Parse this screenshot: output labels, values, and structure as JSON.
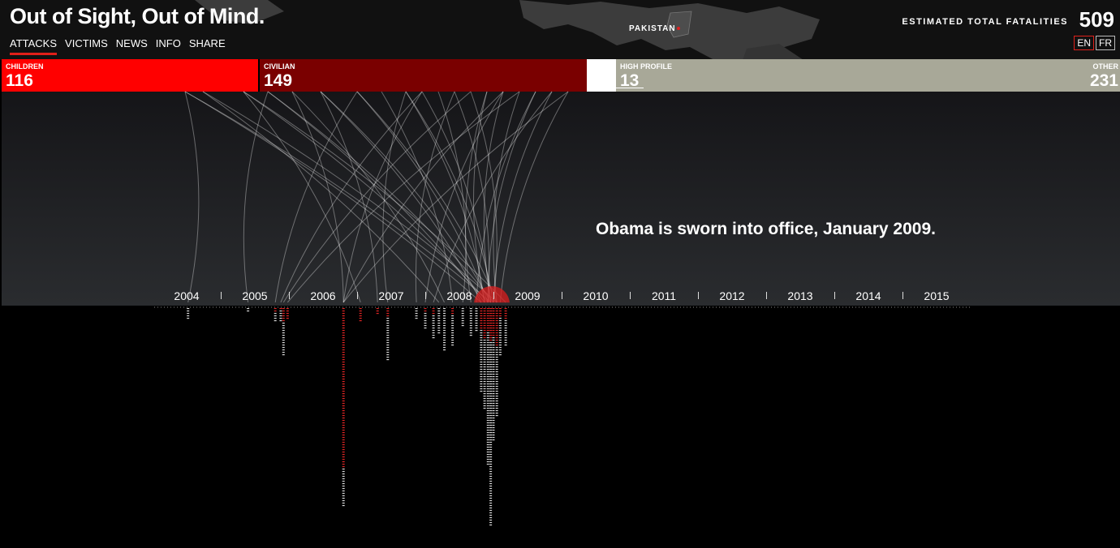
{
  "header": {
    "title": "Out of Sight, Out of Mind.",
    "nav": [
      "ATTACKS",
      "VICTIMS",
      "NEWS",
      "INFO",
      "SHARE"
    ],
    "active_nav": "ATTACKS",
    "country_label": "PAKISTAN",
    "fatalities_label": "ESTIMATED TOTAL FATALITIES",
    "fatalities_value": "509",
    "languages": [
      "EN",
      "FR"
    ],
    "active_language": "EN"
  },
  "categories": [
    {
      "label": "CHILDREN",
      "value": "116",
      "color": "#ff0000"
    },
    {
      "label": "CIVILIAN",
      "value": "149",
      "color": "#7a0000"
    },
    {
      "label": "HIGH PROFILE",
      "value": "13",
      "color": "#a8a898"
    },
    {
      "label": "OTHER",
      "value": "231",
      "color": "#a8a898"
    }
  ],
  "annotation": "Obama is sworn into office, January 2009.",
  "colors": {
    "accent": "#e0201a",
    "children": "#ff0000",
    "civilian": "#7a0000",
    "neutral": "#a8a898"
  },
  "chart_data": {
    "type": "bar",
    "title": "",
    "x_ticks": [
      "2004",
      "2005",
      "2006",
      "2007",
      "2008",
      "2009",
      "2010",
      "2011",
      "2012",
      "2013",
      "2014",
      "2015"
    ],
    "xlim": [
      2004,
      2015
    ],
    "series": [
      {
        "name": "CHILDREN",
        "color": "#e02424"
      },
      {
        "name": "OTHER",
        "color": "#d8d8d8"
      }
    ],
    "attacks": [
      {
        "date": 2004.02,
        "killed": 5,
        "children": 0
      },
      {
        "date": 2004.9,
        "killed": 2,
        "children": 0
      },
      {
        "date": 2005.3,
        "killed": 6,
        "children": 2
      },
      {
        "date": 2005.38,
        "killed": 6,
        "children": 1
      },
      {
        "date": 2005.42,
        "killed": 20,
        "children": 6
      },
      {
        "date": 2005.48,
        "killed": 5,
        "children": 5
      },
      {
        "date": 2006.3,
        "killed": 82,
        "children": 66
      },
      {
        "date": 2006.55,
        "killed": 6,
        "children": 6
      },
      {
        "date": 2006.8,
        "killed": 3,
        "children": 3
      },
      {
        "date": 2006.95,
        "killed": 22,
        "children": 4
      },
      {
        "date": 2007.37,
        "killed": 5,
        "children": 0
      },
      {
        "date": 2007.5,
        "killed": 9,
        "children": 2
      },
      {
        "date": 2007.62,
        "killed": 13,
        "children": 3
      },
      {
        "date": 2007.7,
        "killed": 11,
        "children": 0
      },
      {
        "date": 2007.78,
        "killed": 18,
        "children": 0
      },
      {
        "date": 2007.9,
        "killed": 16,
        "children": 3
      },
      {
        "date": 2008.05,
        "killed": 8,
        "children": 0
      },
      {
        "date": 2008.17,
        "killed": 12,
        "children": 0
      },
      {
        "date": 2008.25,
        "killed": 10,
        "children": 0
      },
      {
        "date": 2008.32,
        "killed": 35,
        "children": 9
      },
      {
        "date": 2008.37,
        "killed": 42,
        "children": 13
      },
      {
        "date": 2008.42,
        "killed": 65,
        "children": 10
      },
      {
        "date": 2008.46,
        "killed": 90,
        "children": 14
      },
      {
        "date": 2008.5,
        "killed": 55,
        "children": 12
      },
      {
        "date": 2008.55,
        "killed": 45,
        "children": 16
      },
      {
        "date": 2008.6,
        "killed": 20,
        "children": 4
      },
      {
        "date": 2008.68,
        "killed": 16,
        "children": 5
      }
    ]
  }
}
